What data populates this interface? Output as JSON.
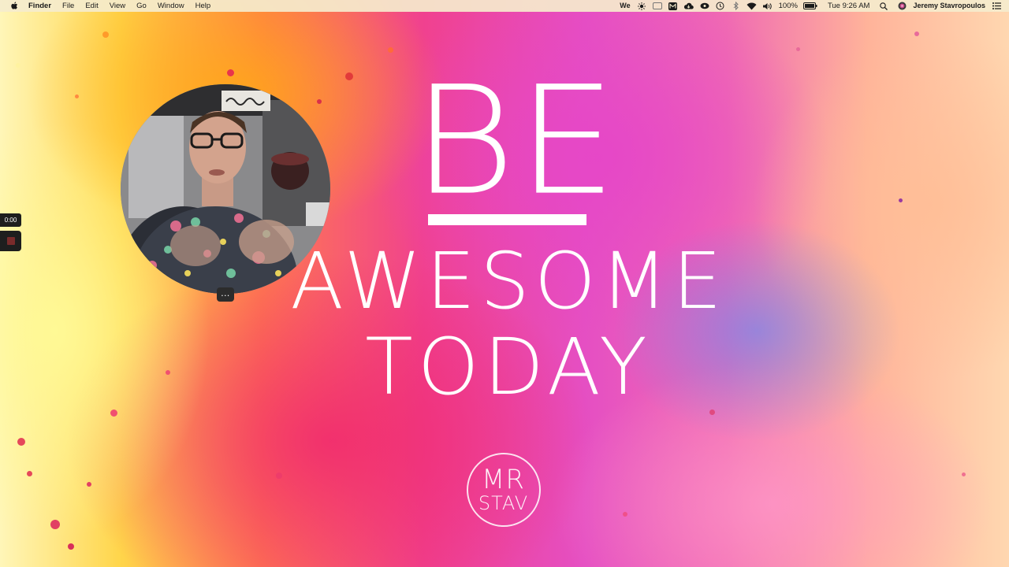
{
  "menubar": {
    "app_name": "Finder",
    "menus": [
      "File",
      "Edit",
      "View",
      "Go",
      "Window",
      "Help"
    ],
    "tray": {
      "battery_percent": "100%",
      "clock": "Tue 9:26 AM",
      "user_name": "Jeremy Stavropoulos",
      "icons": [
        "wechat-icon",
        "brightness-icon",
        "screen-mirror-icon",
        "mail-icon",
        "cloud-icon",
        "eye-icon",
        "time-machine-icon",
        "bluetooth-icon",
        "wifi-icon",
        "volume-icon",
        "battery-icon",
        "spotlight-icon",
        "siri-icon",
        "notification-center-icon"
      ],
      "wechat_label": "We"
    }
  },
  "recorder": {
    "elapsed": "0:00",
    "stop_color": "#7a2b2b"
  },
  "webcam": {
    "more_button": "..."
  },
  "wallpaper": {
    "line1": "BE",
    "line2": "AWESOME",
    "line3": "TODAY",
    "logo_top": "MR",
    "logo_bottom": "STAV"
  }
}
